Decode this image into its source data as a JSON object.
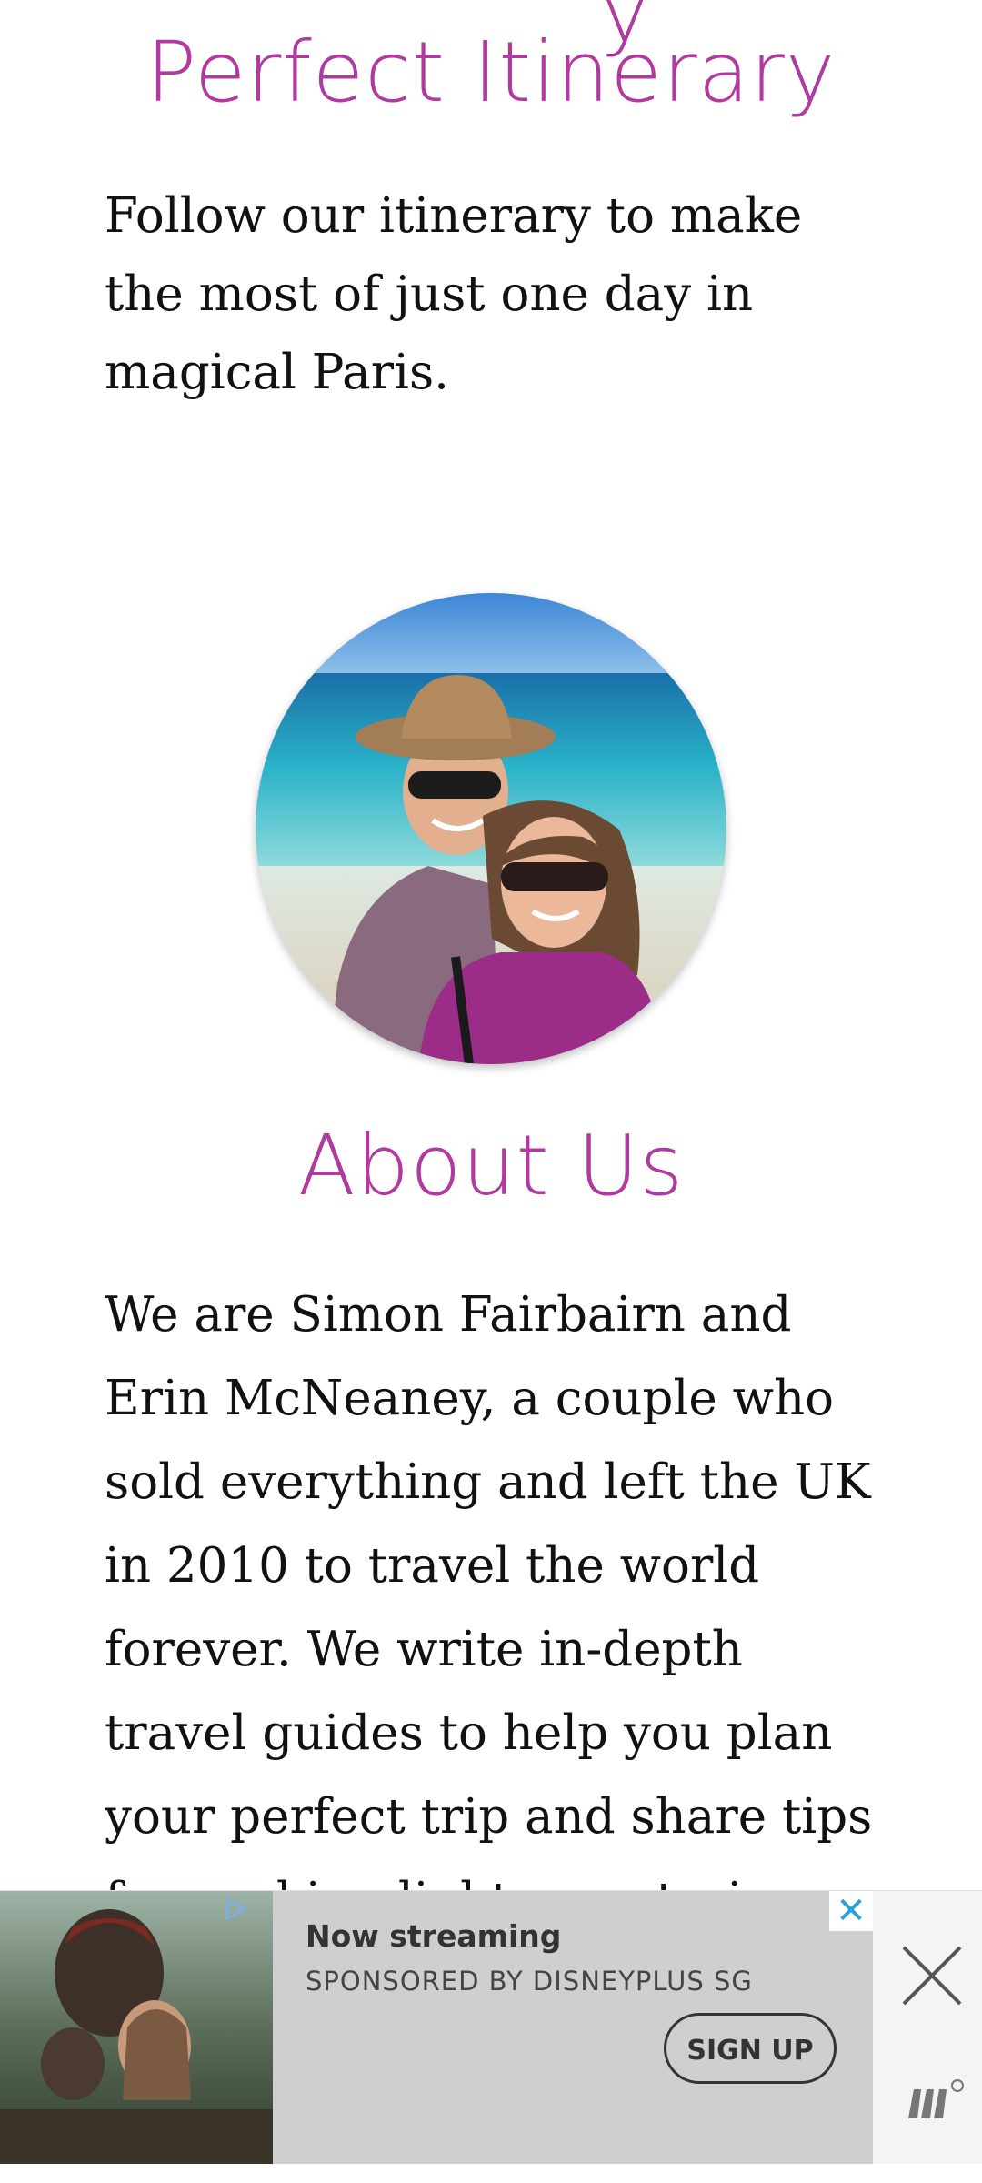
{
  "itinerary": {
    "title": "Perfect Itinerary",
    "body": "Follow our itinerary to make the most of just one day in magical Paris."
  },
  "about": {
    "title": "About Us",
    "body": "We are Simon Fairbairn and Erin McNeaney, a couple who sold everything and left the UK in 2010 to travel the world forever. We write in-depth travel guides to help you plan your perfect trip and share tips for packing light, vegetarian travel and digital"
  },
  "ad": {
    "headline": "Now streaming",
    "sponsor": "SPONSORED BY DISNEYPLUS SG",
    "cta": "SIGN UP",
    "choice_close": "✕",
    "close_icon": "close-icon",
    "brand_icon": "mediavine-icon"
  },
  "colors": {
    "accent": "#b03aa0",
    "ad_bg": "#cfcfcf"
  }
}
